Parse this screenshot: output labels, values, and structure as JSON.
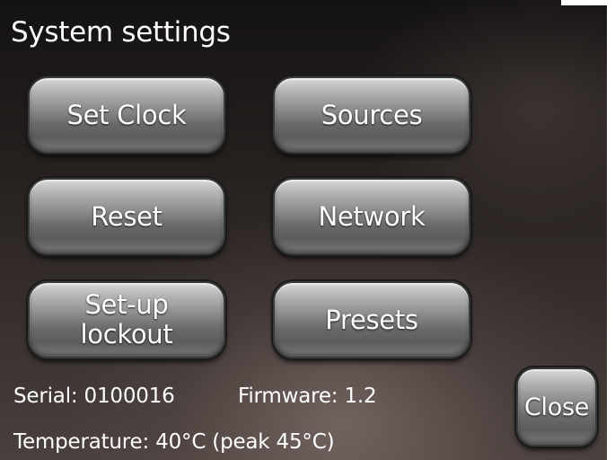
{
  "title": "System settings",
  "buttons": {
    "set_clock": "Set Clock",
    "sources": "Sources",
    "reset": "Reset",
    "network": "Network",
    "setup_lockout": "Set-up\nlockout",
    "presets": "Presets",
    "close": "Close"
  },
  "info": {
    "serial": "Serial: 0100016",
    "firmware": "Firmware: 1.2",
    "temperature": "Temperature: 40°C (peak 45°C)"
  },
  "colors": {
    "text": "#ffffff",
    "button_top": "#d9d9d9",
    "button_bottom": "#5c5c5c",
    "background_dark": "#141212",
    "background_light": "#4a403d"
  }
}
